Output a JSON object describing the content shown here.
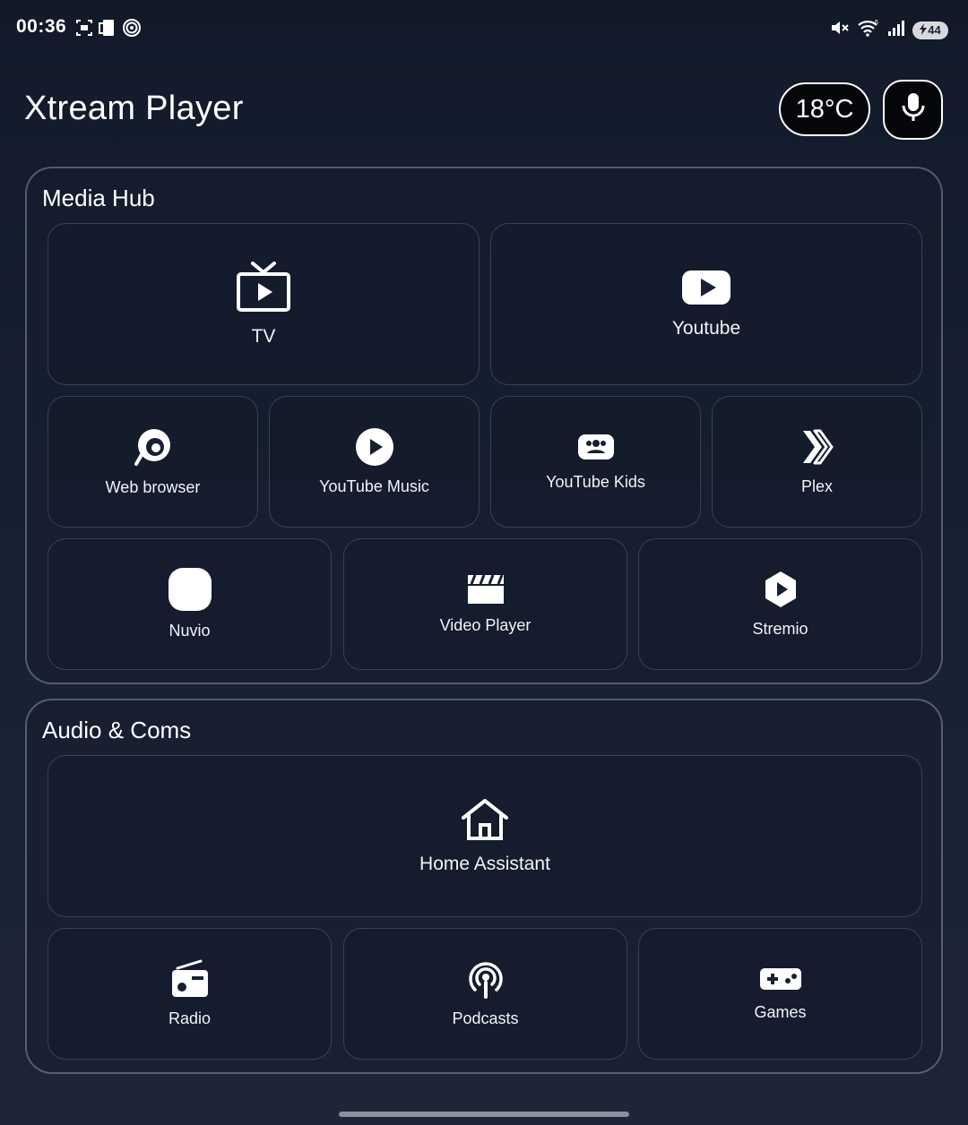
{
  "status_bar": {
    "time": "00:36",
    "battery": "44",
    "left_icons": [
      "screenshot-icon",
      "device-icon",
      "nfc-icon"
    ],
    "right_icons": [
      "mute-icon",
      "wifi-icon",
      "signal-icon",
      "battery-icon"
    ]
  },
  "header": {
    "title": "Xtream Player",
    "temperature": "18°C",
    "mic_icon": "microphone-icon"
  },
  "sections": [
    {
      "title": "Media Hub",
      "tiles": [
        {
          "label": "TV",
          "icon": "tv-icon"
        },
        {
          "label": "Youtube",
          "icon": "youtube-icon"
        },
        {
          "label": "Web browser",
          "icon": "web-browser-icon"
        },
        {
          "label": "YouTube Music",
          "icon": "youtube-music-icon"
        },
        {
          "label": "YouTube Kids",
          "icon": "youtube-kids-icon"
        },
        {
          "label": "Plex",
          "icon": "plex-icon"
        },
        {
          "label": "Nuvio",
          "icon": "nuvio-icon"
        },
        {
          "label": "Video Player",
          "icon": "clapperboard-icon"
        },
        {
          "label": "Stremio",
          "icon": "stremio-icon"
        }
      ]
    },
    {
      "title": "Audio & Coms",
      "tiles": [
        {
          "label": "Home Assistant",
          "icon": "home-icon"
        },
        {
          "label": "Radio",
          "icon": "radio-icon"
        },
        {
          "label": "Podcasts",
          "icon": "podcast-icon"
        },
        {
          "label": "Games",
          "icon": "gamepad-icon"
        }
      ]
    }
  ],
  "colors": {
    "background": "#172033",
    "text": "#ffffff",
    "border": "#3d4456"
  }
}
